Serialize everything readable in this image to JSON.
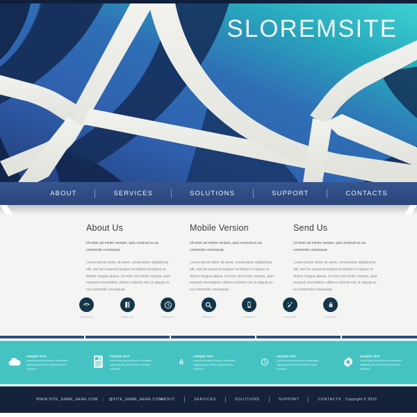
{
  "site": {
    "logo": "SLOREMSITE"
  },
  "colors": {
    "nav_blue": "#2d4b82",
    "teal": "#45c3c3",
    "footer_dark": "#16213a",
    "icon_dark": "#14364a",
    "hero_dark": "#142748",
    "content_bg": "#f4f4f2"
  },
  "nav": {
    "items": [
      {
        "label": "ABOUT"
      },
      {
        "label": "SERVICES"
      },
      {
        "label": "SOLUTIONS"
      },
      {
        "label": "SUPPORT"
      },
      {
        "label": "CONTACTS"
      }
    ]
  },
  "main": {
    "columns": [
      {
        "title": "About Us",
        "lead": "Ut enim ad minim veniam, quis nostrud ex ea commodo consequat.",
        "body": "Lorem ipsum dolor sit amet, consectetur adipisicing elit, sed do eiusmod tempor incididunt ut labore et dolore magna aliqua. Ut enim ad minim veniam, quis nostrud exercitation ullamco laboris nisi ut aliquip ex ea commodo consequat."
      },
      {
        "title": "Mobile Version",
        "lead": "Ut enim ad minim veniam, quis nostrud ex ea commodo consequat.",
        "body": "Lorem ipsum dolor sit amet, consectetur adipisicing elit, sed do eiusmod tempor incididunt ut labore et dolore magna aliqua. Ut enim ad minim veniam, quis nostrud exercitation ullamco laboris nisi ut aliquip ex ea commodo consequat."
      },
      {
        "title": "Send Us",
        "lead": "Ut enim ad minim veniam, quis nostrud ex ea commodo consequat.",
        "body": "Lorem ipsum dolor sit amet, consectetur adipisicing elit, sed do eiusmod tempor incididunt ut labore et dolore magna aliqua. Ut enim ad minim veniam, quis nostrud exercitation ullamco laboris nisi ut aliquip ex ea commodo consequat."
      }
    ],
    "icons": [
      {
        "icon": "phone-icon",
        "caption": "sample text"
      },
      {
        "icon": "book-icon",
        "caption": "sample text"
      },
      {
        "icon": "clock-icon",
        "caption": "sample text"
      },
      {
        "icon": "search-icon",
        "caption": "sample text"
      },
      {
        "icon": "mobile-icon",
        "caption": "sample text"
      },
      {
        "icon": "magic-wand-icon",
        "caption": "sample text"
      },
      {
        "icon": "lock-icon",
        "caption": "sample text"
      }
    ]
  },
  "features": [
    {
      "icon": "cloud-icon",
      "title": "sample text",
      "body": "Lorem ipsum dolor sit amet, consectetur adipisicing elit, sed do eiusmod tempor incididunt."
    },
    {
      "icon": "document-icon",
      "title": "sample text",
      "body": "Lorem ipsum dolor sit amet, consectetur adipisicing elit, sed do eiusmod tempor incididunt."
    },
    {
      "icon": "lock-icon",
      "title": "sample text",
      "body": "Lorem ipsum dolor sit amet, consectetur adipisicing elit, sed do eiusmod tempor incididunt."
    },
    {
      "icon": "clock-icon",
      "title": "sample text",
      "body": "Lorem ipsum dolor sit amet, consectetur adipisicing elit, sed do eiusmod tempor incididunt."
    },
    {
      "icon": "gear-icon",
      "title": "sample text",
      "body": "Lorem ipsum dolor sit amet, consectetur adipisicing elit, sed do eiusmod tempor incididunt."
    }
  ],
  "footer": {
    "website": "WWW.SITE_NAME_HERE.COM",
    "separator": "|",
    "email": "@SITE_NAME_HERE.COM",
    "nav": [
      {
        "label": "ABOUT"
      },
      {
        "label": "SERVICES"
      },
      {
        "label": "SOLUTIONS"
      },
      {
        "label": "SUPPORT"
      },
      {
        "label": "CONTACTS"
      }
    ],
    "copyright": "Copyright © 2013"
  }
}
